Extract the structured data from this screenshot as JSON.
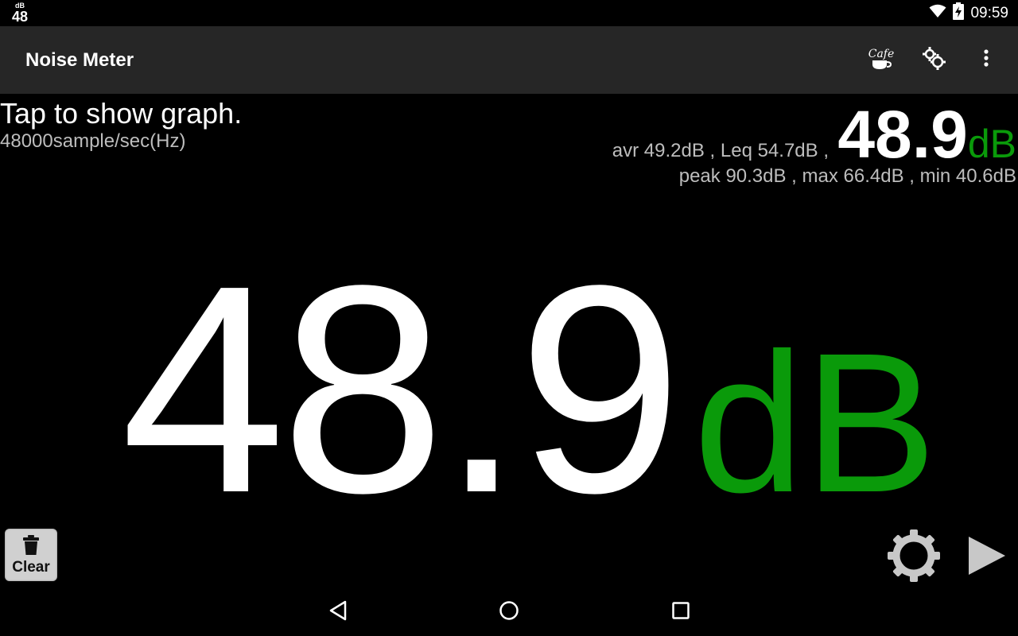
{
  "status_bar": {
    "app_icon_small": "dB",
    "app_icon_big": "48",
    "time": "09:59",
    "icons": [
      "wifi-icon",
      "battery-charging-icon"
    ]
  },
  "toolbar": {
    "title": "Noise Meter",
    "actions": [
      {
        "name": "cafe-icon",
        "label": "Cafe"
      },
      {
        "name": "settings-icon"
      },
      {
        "name": "overflow-menu-icon"
      }
    ]
  },
  "main": {
    "hint": "Tap to show graph.",
    "sample_rate": "48000sample/sec(Hz)",
    "small_value": "48.9",
    "small_unit": "dB",
    "stats_line1": "avr 49.2dB , Leq 54.7dB ,",
    "stats_line2": "peak 90.3dB , max 66.4dB , min 40.6dB",
    "big_value": "48.9",
    "big_unit": "dB",
    "clear_label": "Clear"
  },
  "colors": {
    "accent_green": "#0a9a0a",
    "toolbar_bg": "#262626",
    "background": "#000000",
    "secondary_text": "#bdbdbd"
  },
  "nav_bar": {
    "icons": [
      "back-icon",
      "home-icon",
      "recents-icon"
    ]
  }
}
